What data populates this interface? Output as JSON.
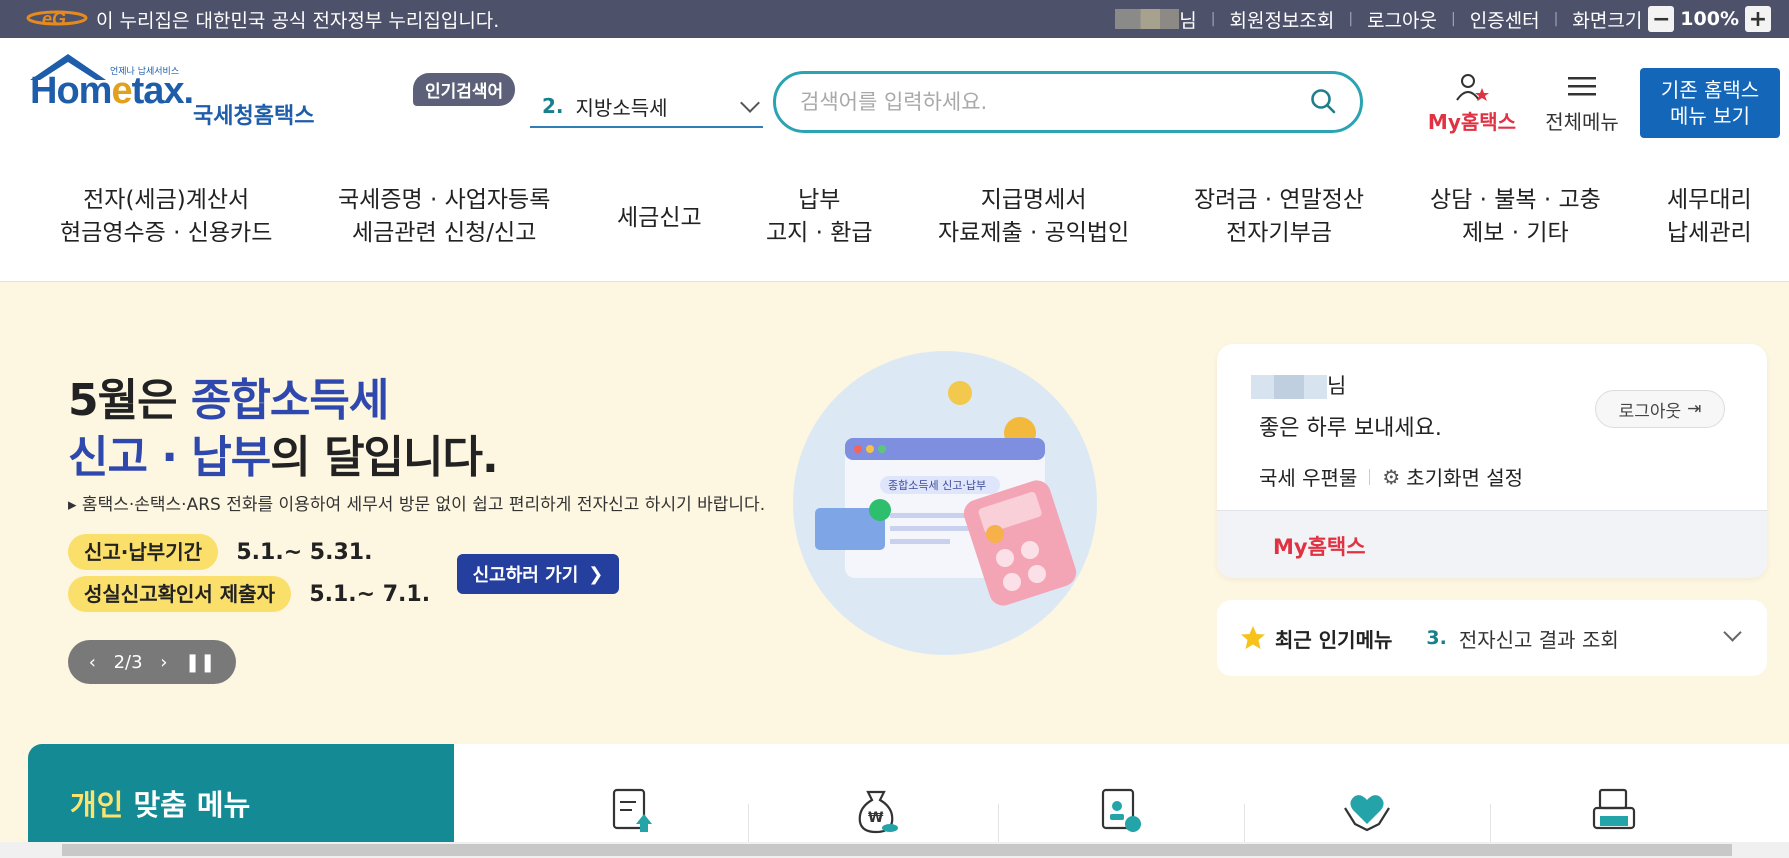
{
  "topbar": {
    "notice": "이 누리집은 대한민국 공식 전자정부 누리집입니다.",
    "user_suffix": "님",
    "links": [
      "회원정보조회",
      "로그아웃",
      "인증센터"
    ],
    "zoom_label": "화면크기",
    "zoom_minus": "−",
    "zoom_value": "100%",
    "zoom_plus": "+"
  },
  "logo": {
    "text_home": "Hom",
    "text_e": "e",
    "text_tax": "tax.",
    "kor": "국세청홈택스",
    "small": "언제나 납세서비스"
  },
  "search": {
    "popular_tag": "인기검색어",
    "popular_num": "2.",
    "popular_value": "지방소득세",
    "placeholder": "검색어를 입력하세요."
  },
  "header_actions": {
    "myhome": "My홈택스",
    "allmenu": "전체메뉴",
    "old_line1": "기존 홈택스",
    "old_line2": "메뉴 보기"
  },
  "gnb": [
    {
      "l1": "전자(세금)계산서",
      "l2": "현금영수증 · 신용카드"
    },
    {
      "l1": "국세증명 · 사업자등록",
      "l2": "세금관련 신청/신고"
    },
    {
      "l1": "세금신고",
      "l2": ""
    },
    {
      "l1": "납부",
      "l2": "고지 · 환급"
    },
    {
      "l1": "지급명세서",
      "l2": "자료제출 · 공익법인"
    },
    {
      "l1": "장려금 · 연말정산",
      "l2": "전자기부금"
    },
    {
      "l1": "상담 · 불복 · 고충",
      "l2": "제보 · 기타"
    },
    {
      "l1": "세무대리",
      "l2": "납세관리"
    }
  ],
  "hero": {
    "title_a": "5월은 ",
    "title_b": "종합소득세",
    "title_c": "신고 · 납부",
    "title_d": "의 달입니다.",
    "desc": "▸ 홈택스·손택스·ARS 전화를 이용하여 세무서 방문 없이 쉽고 편리하게 전자신고 하시기 바랍니다.",
    "period1_label": "신고·납부기간",
    "period1_date": "5.1.~ 5.31.",
    "period2_label": "성실신고확인서 제출자",
    "period2_date": "5.1.~ 7.1.",
    "go_button": "신고하러 가기",
    "pager": "2/3",
    "illus_label": "종합소득세 신고·납부"
  },
  "login": {
    "name_suffix": "님",
    "greeting": "좋은 하루 보내세요.",
    "logout": "로그아웃",
    "link1": "국세 우편물",
    "link2": "초기화면 설정",
    "myhome": "My홈택스"
  },
  "recent": {
    "title": "최근 인기메뉴",
    "num": "3.",
    "value": "전자신고 결과 조회"
  },
  "personal": {
    "title_a": "개인",
    "title_b": " 맞춤 메뉴"
  },
  "colors": {
    "topbar": "#4e516a",
    "accent": "#1466b8",
    "teal": "#148a94",
    "hero_bg": "#fdf6e1",
    "red": "#e03243"
  }
}
